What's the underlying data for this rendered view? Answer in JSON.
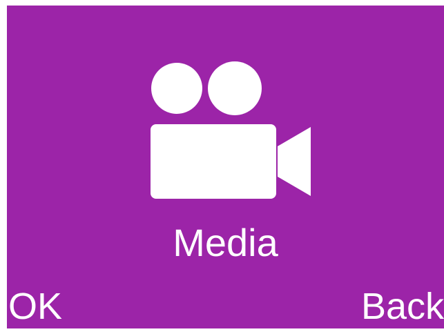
{
  "app": {
    "label": "Media",
    "icon": "video-camera-icon"
  },
  "softkeys": {
    "left_label": "OK",
    "right_label": "Back"
  },
  "colors": {
    "background": "#9c24a8",
    "foreground": "#ffffff",
    "frame": "#ffffff"
  }
}
